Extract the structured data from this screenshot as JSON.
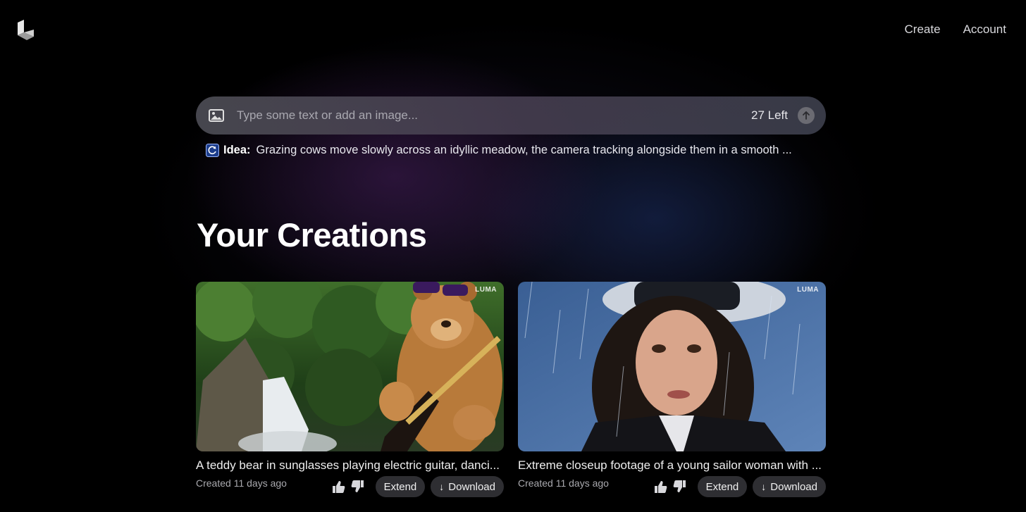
{
  "nav": {
    "create": "Create",
    "account": "Account"
  },
  "prompt": {
    "placeholder": "Type some text or add an image...",
    "remaining": "27 Left"
  },
  "idea": {
    "label": "Idea:",
    "text": "Grazing cows move slowly across an idyllic meadow, the camera tracking alongside them in a smooth ..."
  },
  "section_title": "Your Creations",
  "creations": [
    {
      "watermark": "LUMA",
      "title": "A teddy bear in sunglasses playing electric guitar, danci...",
      "created": "Created 11 days ago",
      "extend_label": "Extend",
      "download_label": "Download",
      "download_icon": "↓"
    },
    {
      "watermark": "LUMA",
      "title": "Extreme closeup footage of a young sailor woman with ...",
      "created": "Created 11 days ago",
      "extend_label": "Extend",
      "download_label": "Download",
      "download_icon": "↓"
    }
  ],
  "icons": [
    "luma-logo-icon",
    "image-icon",
    "send-arrow-icon",
    "idea-refresh-icon",
    "thumbs-up-icon",
    "thumbs-down-icon",
    "download-arrow-icon"
  ],
  "colors": {
    "background": "#000000",
    "pill": "#2e2e32",
    "prompt_bar": "#4e4e56"
  }
}
